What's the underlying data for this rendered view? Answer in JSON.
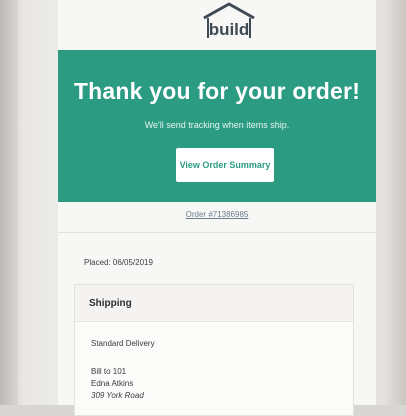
{
  "brand": {
    "logo_text": "build",
    "accent_color": "#2b9b82"
  },
  "banner": {
    "title": "Thank you for your order!",
    "subtitle": "We'll send tracking when items ship.",
    "button_label": "View Order Summary"
  },
  "order": {
    "link_text": "Order #71386985",
    "placed_label": "Placed: 06/05/2019"
  },
  "shipping": {
    "title": "Shipping",
    "method": "Standard Delivery",
    "address": [
      "Bill to 101",
      "Edna Atkins",
      "309 York Road"
    ]
  }
}
